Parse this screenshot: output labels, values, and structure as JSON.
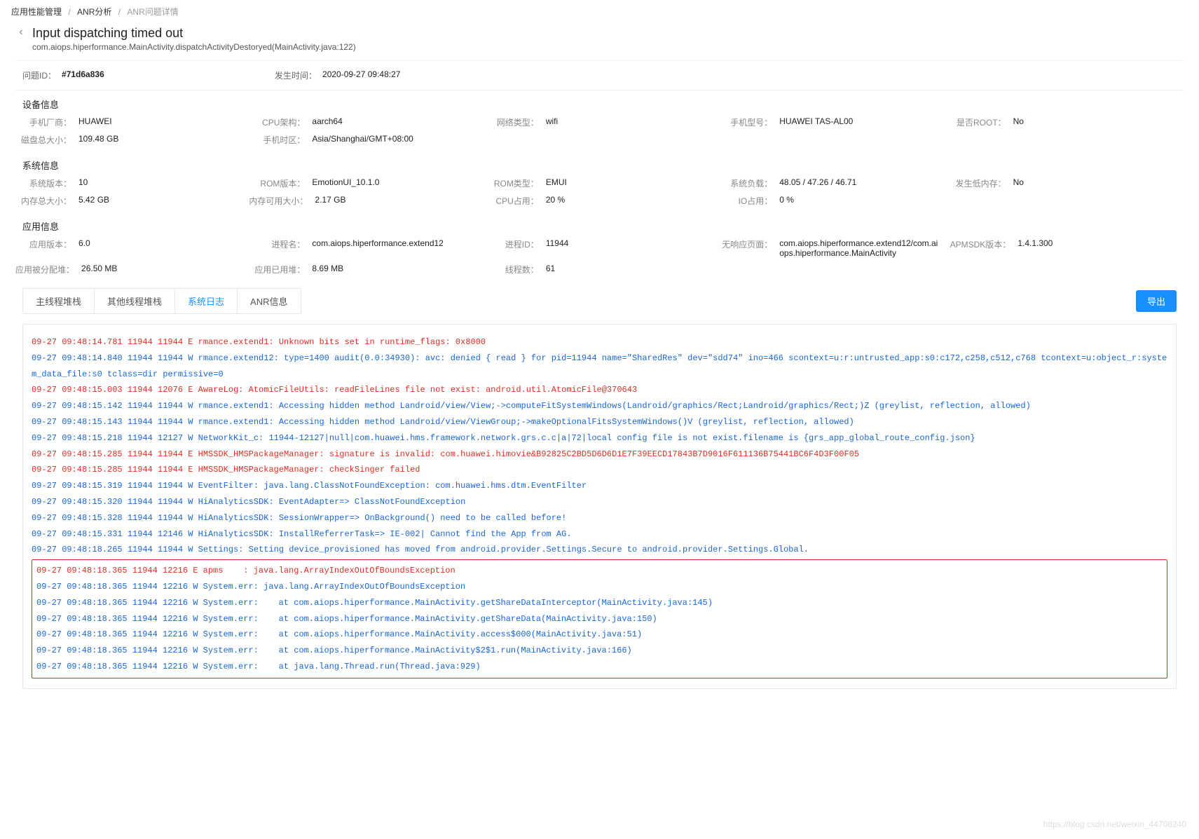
{
  "breadcrumb": {
    "a": "应用性能管理",
    "b": "ANR分析",
    "c": "ANR问题详情"
  },
  "title": "Input dispatching timed out",
  "subtitle": "com.aiops.hiperformance.MainActivity.dispatchActivityDestoryed(MainActivity.java:122)",
  "id_row": {
    "issue_id_label": "问题ID：",
    "issue_id": "#71d6a836",
    "time_label": "发生时间：",
    "time": "2020-09-27 09:48:27"
  },
  "sections": {
    "device_title": "设备信息",
    "device": [
      [
        {
          "lab": "手机厂商：",
          "val": "HUAWEI"
        },
        {
          "lab": "CPU架构：",
          "val": "aarch64"
        },
        {
          "lab": "网络类型：",
          "val": "wifi"
        },
        {
          "lab": "手机型号：",
          "val": "HUAWEI TAS-AL00"
        },
        {
          "lab": "是否ROOT：",
          "val": "No"
        }
      ],
      [
        {
          "lab": "磁盘总大小：",
          "val": "109.48 GB"
        },
        {
          "lab": "手机时区：",
          "val": "Asia/Shanghai/GMT+08:00"
        },
        {},
        {},
        {}
      ]
    ],
    "system_title": "系统信息",
    "system": [
      [
        {
          "lab": "系统版本：",
          "val": "10"
        },
        {
          "lab": "ROM版本：",
          "val": "EmotionUI_10.1.0"
        },
        {
          "lab": "ROM类型：",
          "val": "EMUI"
        },
        {
          "lab": "系统负载：",
          "val": "48.05 / 47.26 / 46.71"
        },
        {
          "lab": "发生低内存：",
          "val": "No"
        }
      ],
      [
        {
          "lab": "内存总大小：",
          "val": "5.42 GB"
        },
        {
          "lab": "内存可用大小：",
          "val": "2.17 GB"
        },
        {
          "lab": "CPU占用：",
          "val": "20 %"
        },
        {
          "lab": "IO占用：",
          "val": "0 %"
        },
        {}
      ]
    ],
    "app_title": "应用信息",
    "app": [
      [
        {
          "lab": "应用版本：",
          "val": "6.0"
        },
        {
          "lab": "进程名：",
          "val": "com.aiops.hiperformance.extend12"
        },
        {
          "lab": "进程ID：",
          "val": "11944"
        },
        {
          "lab": "无响应页面：",
          "val": "com.aiops.hiperformance.extend12/com.aiops.hiperformance.MainActivity"
        },
        {
          "lab": "APMSDK版本：",
          "val": "1.4.1.300"
        }
      ],
      [
        {
          "lab": "应用被分配堆：",
          "val": "26.50 MB"
        },
        {
          "lab": "应用已用堆：",
          "val": "8.69 MB"
        },
        {
          "lab": "线程数：",
          "val": "61"
        },
        {},
        {}
      ]
    ]
  },
  "tabs": [
    "主线程堆栈",
    "其他线程堆栈",
    "系统日志",
    "ANR信息"
  ],
  "active_tab": 2,
  "export_label": "导出",
  "logs": [
    {
      "lv": "E",
      "t": "09-27 09:48:14.781 11944 11944 E rmance.extend1: Unknown bits set in runtime_flags: 0x8000"
    },
    {
      "lv": "W",
      "t": "09-27 09:48:14.840 11944 11944 W rmance.extend12: type=1400 audit(0.0:34930): avc: denied { read } for pid=11944 name=\"SharedRes\" dev=\"sdd74\" ino=466 scontext=u:r:untrusted_app:s0:c172,c258,c512,c768 tcontext=u:object_r:system_data_file:s0 tclass=dir permissive=0"
    },
    {
      "lv": "E",
      "t": "09-27 09:48:15.003 11944 12076 E AwareLog: AtomicFileUtils: readFileLines file not exist: android.util.AtomicFile@370643"
    },
    {
      "lv": "W",
      "t": "09-27 09:48:15.142 11944 11944 W rmance.extend1: Accessing hidden method Landroid/view/View;->computeFitSystemWindows(Landroid/graphics/Rect;Landroid/graphics/Rect;)Z (greylist, reflection, allowed)"
    },
    {
      "lv": "W",
      "t": "09-27 09:48:15.143 11944 11944 W rmance.extend1: Accessing hidden method Landroid/view/ViewGroup;->makeOptionalFitsSystemWindows()V (greylist, reflection, allowed)"
    },
    {
      "lv": "W",
      "t": "09-27 09:48:15.218 11944 12127 W NetworkKit_c: 11944-12127|null|com.huawei.hms.framework.network.grs.c.c|a|72|local config file is not exist.filename is {grs_app_global_route_config.json}"
    },
    {
      "lv": "E",
      "t": "09-27 09:48:15.285 11944 11944 E HMSSDK_HMSPackageManager: signature is invalid: com.huawei.himovie&B92825C2BD5D6D6D1E7F39EECD17843B7D9016F611136B75441BC6F4D3F00F05"
    },
    {
      "lv": "E",
      "t": "09-27 09:48:15.285 11944 11944 E HMSSDK_HMSPackageManager: checkSinger failed"
    },
    {
      "lv": "W",
      "t": "09-27 09:48:15.319 11944 11944 W EventFilter: java.lang.ClassNotFoundException: com.huawei.hms.dtm.EventFilter"
    },
    {
      "lv": "W",
      "t": "09-27 09:48:15.320 11944 11944 W HiAnalyticsSDK: EventAdapter=> ClassNotFoundException"
    },
    {
      "lv": "W",
      "t": "09-27 09:48:15.328 11944 11944 W HiAnalyticsSDK: SessionWrapper=> OnBackground() need to be called before!"
    },
    {
      "lv": "W",
      "t": "09-27 09:48:15.331 11944 12146 W HiAnalyticsSDK: InstallReferrerTask=> IE-002| Cannot find the App from AG."
    },
    {
      "lv": "W",
      "t": "09-27 09:48:18.265 11944 11944 W Settings: Setting device_provisioned has moved from android.provider.Settings.Secure to android.provider.Settings.Global."
    }
  ],
  "highlight_logs": [
    {
      "lv": "E",
      "t": "09-27 09:48:18.365 11944 12216 E apms    : java.lang.ArrayIndexOutOfBoundsException"
    },
    {
      "lv": "W",
      "t": "09-27 09:48:18.365 11944 12216 W System.err: java.lang.ArrayIndexOutOfBoundsException"
    },
    {
      "lv": "W",
      "t": "09-27 09:48:18.365 11944 12216 W System.err:    at com.aiops.hiperformance.MainActivity.getShareDataInterceptor(MainActivity.java:145)"
    },
    {
      "lv": "W",
      "t": "09-27 09:48:18.365 11944 12216 W System.err:    at com.aiops.hiperformance.MainActivity.getShareData(MainActivity.java:150)"
    },
    {
      "lv": "W",
      "t": "09-27 09:48:18.365 11944 12216 W System.err:    at com.aiops.hiperformance.MainActivity.access$000(MainActivity.java:51)"
    },
    {
      "lv": "W",
      "t": "09-27 09:48:18.365 11944 12216 W System.err:    at com.aiops.hiperformance.MainActivity$2$1.run(MainActivity.java:166)"
    },
    {
      "lv": "W",
      "t": "09-27 09:48:18.365 11944 12216 W System.err:    at java.lang.Thread.run(Thread.java:929)"
    }
  ],
  "watermark": "https://blog.csdn.net/weixin_44708240"
}
